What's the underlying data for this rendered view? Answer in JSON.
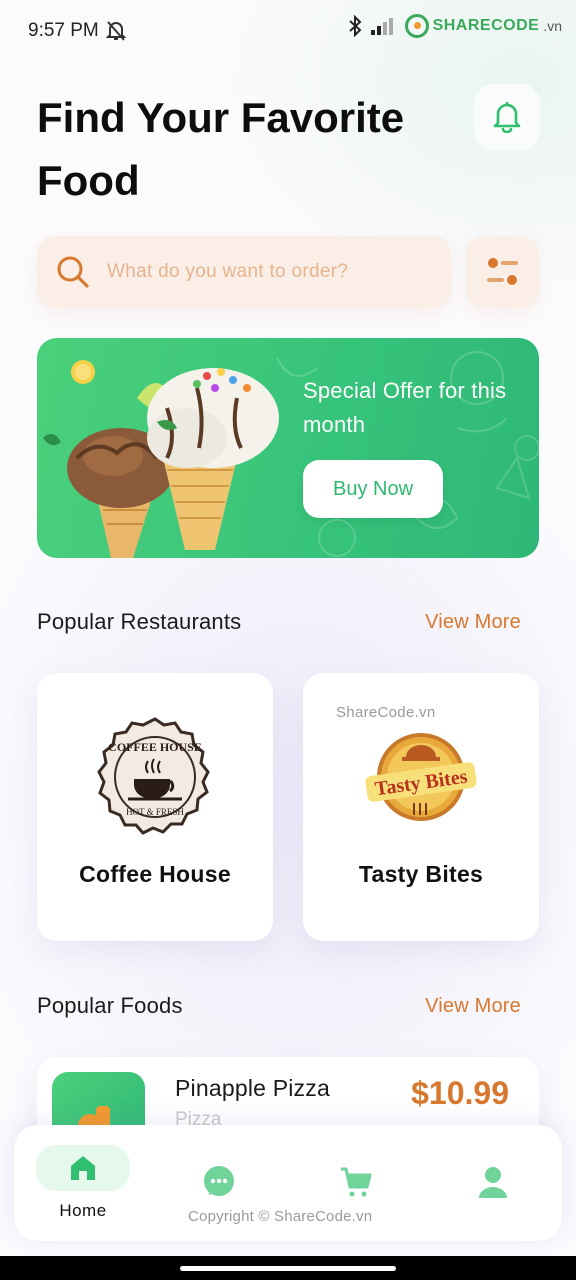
{
  "status_bar": {
    "time": "9:57 PM",
    "watermark_brand": "SHARECODE",
    "watermark_domain": ".vn"
  },
  "header": {
    "title": "Find Your Favorite Food"
  },
  "search": {
    "placeholder": "What do you want to order?"
  },
  "banner": {
    "text": "Special Offer for this month",
    "button_label": "Buy Now"
  },
  "restaurants": {
    "section_title": "Popular Restaurants",
    "view_more": "View More",
    "items": [
      {
        "name": "Coffee House",
        "logo_text_top": "COFFEE HOUSE",
        "logo_text_bottom": "HOT & FRESH"
      },
      {
        "name": "Tasty Bites",
        "logo_text": "Tasty Bites"
      }
    ],
    "watermark": "ShareCode.vn"
  },
  "foods": {
    "section_title": "Popular Foods",
    "view_more": "View More",
    "items": [
      {
        "name": "Pinapple Pizza",
        "category": "Pizza",
        "price": "$10.99"
      }
    ]
  },
  "bottom_nav": {
    "home_label": "Home",
    "icons": [
      "home-icon",
      "chat-icon",
      "cart-icon",
      "profile-icon"
    ]
  },
  "copyright": "Copyright © ShareCode.vn",
  "colors": {
    "accent_green": "#37c47a",
    "accent_orange": "#d8782e",
    "search_bg": "#faeee6"
  }
}
